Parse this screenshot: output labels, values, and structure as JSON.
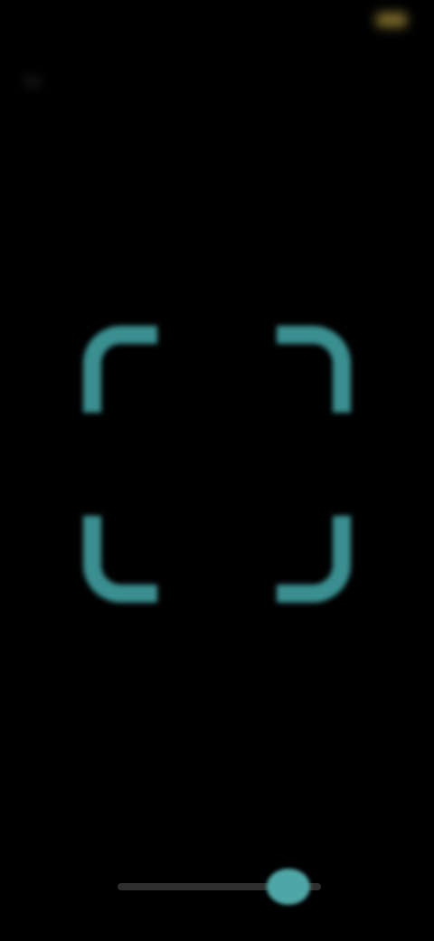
{
  "status_bar": {
    "time": "",
    "right_text": ""
  },
  "app_bar": {
    "back_icon": "←",
    "title": "",
    "action_label": ""
  },
  "scan_frame": {
    "accent_color": "#3a8f90"
  },
  "zoom_slider": {
    "value": 0.84,
    "thumb_color": "#4ea6a6"
  },
  "icons": {
    "back": "back-arrow-icon",
    "battery": "battery-icon"
  }
}
